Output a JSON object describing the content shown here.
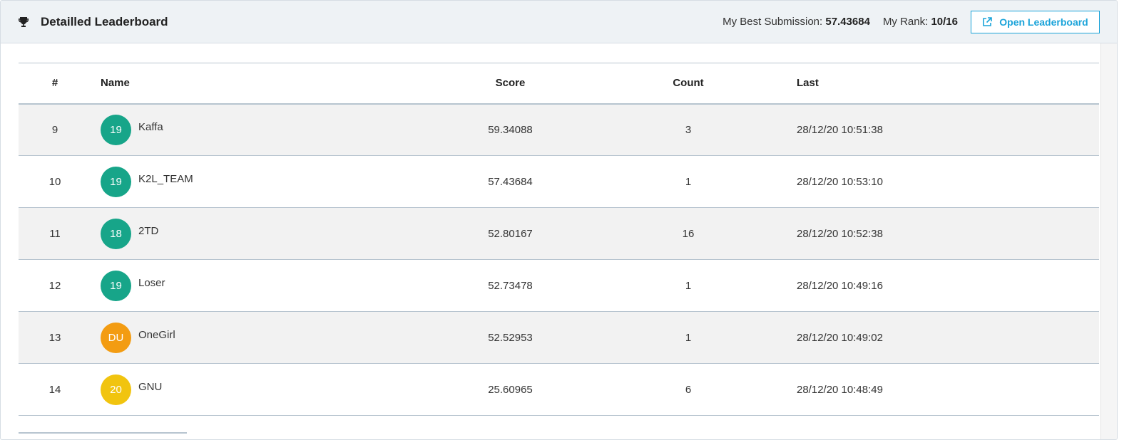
{
  "header": {
    "title": "Detailled Leaderboard",
    "best_label": "My Best Submission: ",
    "best_value": "57.43684",
    "rank_label": "My Rank: ",
    "rank_value": "10/16",
    "open_button": "Open Leaderboard",
    "trophy_icon": "trophy-icon",
    "open_icon": "external-link-icon",
    "accent_color": "#1aa3d9"
  },
  "table": {
    "columns": [
      "#",
      "Name",
      "Score",
      "Count",
      "Last"
    ],
    "rows": [
      {
        "rank": "9",
        "avatar": "19",
        "avatar_color": "#17a589",
        "name": "Kaffa",
        "score": "59.34088",
        "count": "3",
        "last": "28/12/20 10:51:38"
      },
      {
        "rank": "10",
        "avatar": "19",
        "avatar_color": "#17a589",
        "name": "K2L_TEAM",
        "score": "57.43684",
        "count": "1",
        "last": "28/12/20 10:53:10"
      },
      {
        "rank": "11",
        "avatar": "18",
        "avatar_color": "#17a589",
        "name": "2TD",
        "score": "52.80167",
        "count": "16",
        "last": "28/12/20 10:52:38"
      },
      {
        "rank": "12",
        "avatar": "19",
        "avatar_color": "#17a589",
        "name": "Loser",
        "score": "52.73478",
        "count": "1",
        "last": "28/12/20 10:49:16"
      },
      {
        "rank": "13",
        "avatar": "DU",
        "avatar_color": "#f39c12",
        "name": "OneGirl",
        "score": "52.52953",
        "count": "1",
        "last": "28/12/20 10:49:02"
      },
      {
        "rank": "14",
        "avatar": "20",
        "avatar_color": "#f1c40f",
        "name": "GNU",
        "score": "25.60965",
        "count": "6",
        "last": "28/12/20 10:48:49"
      }
    ]
  }
}
